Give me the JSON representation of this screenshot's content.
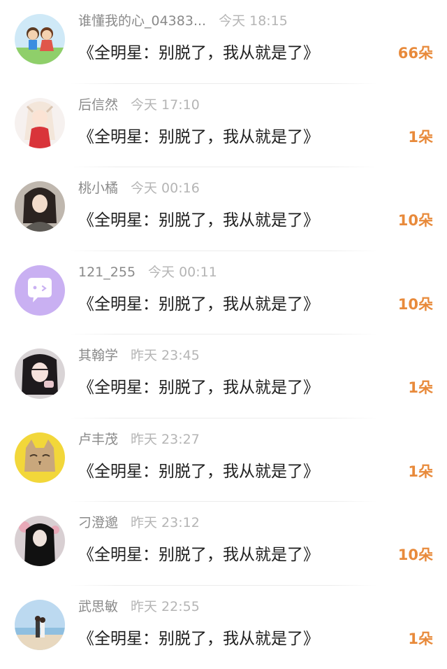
{
  "items": [
    {
      "name": "谁懂我的心_04383...",
      "time": "今天 18:15",
      "message": "《全明星：别脱了，我从就是了》",
      "count": "66朵",
      "avatar_icon": "cartoon-kids-avatar-icon"
    },
    {
      "name": "后信然",
      "time": "今天 17:10",
      "message": "《全明星：别脱了，我从就是了》",
      "count": "1朵",
      "avatar_icon": "anime-girl-avatar-icon"
    },
    {
      "name": "桃小橘",
      "time": "今天 00:16",
      "message": "《全明星：别脱了，我从就是了》",
      "count": "10朵",
      "avatar_icon": "girl-photo-avatar-icon"
    },
    {
      "name": "121_255",
      "time": "今天 00:11",
      "message": "《全明星：别脱了，我从就是了》",
      "count": "10朵",
      "avatar_icon": "chat-bubble-avatar-icon"
    },
    {
      "name": "其翰学",
      "time": "昨天 23:45",
      "message": "《全明星：别脱了，我从就是了》",
      "count": "1朵",
      "avatar_icon": "girl-selfie-avatar-icon"
    },
    {
      "name": "卢丰茂",
      "time": "昨天 23:27",
      "message": "《全明星：别脱了，我从就是了》",
      "count": "1朵",
      "avatar_icon": "cat-drawing-avatar-icon"
    },
    {
      "name": "刁澄邈",
      "time": "昨天 23:12",
      "message": "《全明星：别脱了，我从就是了》",
      "count": "10朵",
      "avatar_icon": "dark-portrait-avatar-icon"
    },
    {
      "name": "武思敏",
      "time": "昨天 22:55",
      "message": "《全明星：别脱了，我从就是了》",
      "count": "1朵",
      "avatar_icon": "beach-couple-avatar-icon"
    }
  ],
  "colors": {
    "accent": "#e88a3b",
    "name": "#8a8a8a",
    "time": "#b5b5b5",
    "text": "#1e1e1e",
    "avatar_purple": "#c9b0f2"
  }
}
